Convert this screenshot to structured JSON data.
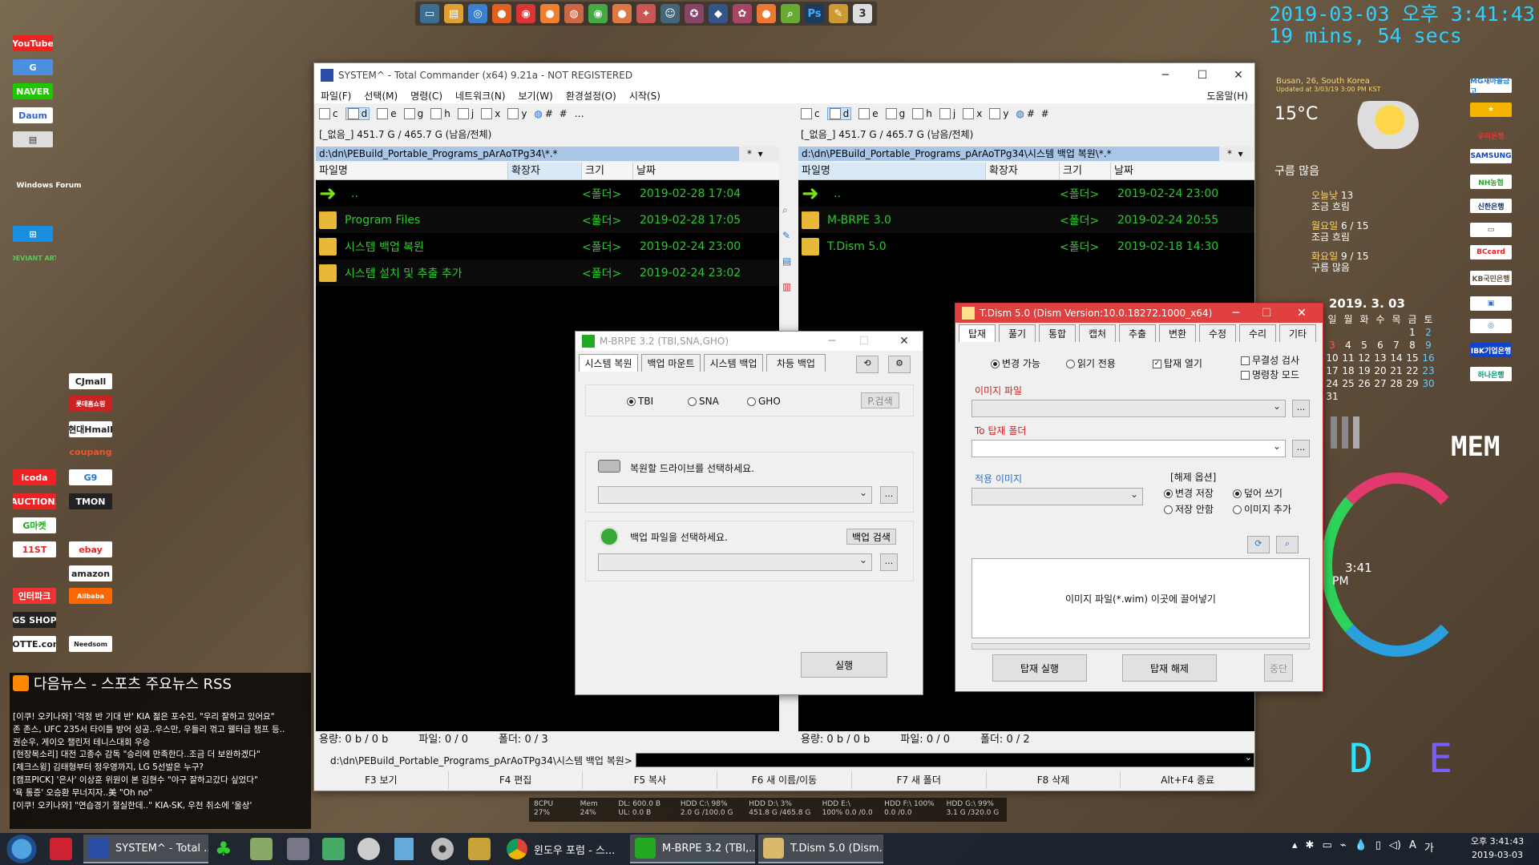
{
  "overlay_clock": {
    "datetime": "2019-03-03 오후 3:41:43",
    "uptime": "19 mins, 54 secs"
  },
  "tc": {
    "title": "SYSTEM^ - Total Commander (x64) 9.21a - NOT REGISTERED",
    "menu": [
      "파일(F)",
      "선택(M)",
      "명령(C)",
      "네트워크(N)",
      "보기(W)",
      "환경설정(O)",
      "시작(S)"
    ],
    "help": "도움말(H)",
    "drives": [
      "c",
      "d",
      "e",
      "g",
      "h",
      "j",
      "x",
      "y",
      "#",
      "…"
    ],
    "diskinfo": "[_없음_]  451.7 G / 465.7 G (남음/전체)",
    "left": {
      "path": "d:\\dn\\PEBuild_Portable_Programs_pArAoTPg34\\*.*",
      "cols": [
        "파일명",
        "확장자",
        "크기",
        "날짜"
      ],
      "rows": [
        {
          "name": "..",
          "size": "<폴더>",
          "date": "2019-02-28 17:04"
        },
        {
          "name": "Program Files",
          "size": "<폴더>",
          "date": "2019-02-28 17:05"
        },
        {
          "name": "시스템 백업 복원",
          "size": "<폴더>",
          "date": "2019-02-24 23:00"
        },
        {
          "name": "시스템 설치 및 추출 추가",
          "size": "<폴더>",
          "date": "2019-02-24 23:02"
        }
      ],
      "status": {
        "sel": "용량: 0 b / 0 b",
        "files": "파일: 0 / 0",
        "folders": "폴더: 0 / 3"
      }
    },
    "right": {
      "path": "d:\\dn\\PEBuild_Portable_Programs_pArAoTPg34\\시스템 백업 복원\\*.*",
      "cols": [
        "파일명",
        "확장자",
        "크기",
        "날짜"
      ],
      "rows": [
        {
          "name": "..",
          "size": "<폴더>",
          "date": "2019-02-24 23:00"
        },
        {
          "name": "M-BRPE 3.0",
          "size": "<폴더>",
          "date": "2019-02-24 20:55"
        },
        {
          "name": "T.Dism 5.0",
          "size": "<폴더>",
          "date": "2019-02-18 14:30"
        }
      ],
      "status": {
        "sel": "용량: 0 b / 0 b",
        "files": "파일: 0 / 0",
        "folders": "폴더: 0 / 2"
      }
    },
    "cmdpath": "d:\\dn\\PEBuild_Portable_Programs_pArAoTPg34\\시스템 백업 복원>",
    "fnkeys": [
      "F3 보기",
      "F4 편집",
      "F5 복사",
      "F6 새 이름/이동",
      "F7 새 폴더",
      "F8 삭제",
      "Alt+F4 종료"
    ]
  },
  "mbrpe": {
    "title": "M-BRPE 3.2 (TBI,SNA,GHO)",
    "tabs": [
      "시스템 복원",
      "백업 마운트",
      "시스템 백업",
      "차등 백업"
    ],
    "formats": [
      "TBI",
      "SNA",
      "GHO"
    ],
    "search_btn": "P.검색",
    "drive_label": "복원할 드라이브를 선택하세요.",
    "backup_label": "백업 파일을 선택하세요.",
    "backup_search": "백업 검색",
    "browse": "...",
    "run": "실행"
  },
  "tdism": {
    "title": "T.Dism 5.0 (Dism Version:10.0.18272.1000_x64)",
    "tabs": [
      "탑재",
      "풀기",
      "통합",
      "캡처",
      "추출",
      "변환",
      "수정",
      "수리",
      "기타"
    ],
    "opt_rw": "변경 가능",
    "opt_ro": "읽기 전용",
    "opt_open": "탑재 열기",
    "opt_integrity": "무결성 검사",
    "opt_cmd": "명령창 모드",
    "image_file": "이미지 파일",
    "mount_folder": "To 탑재 폴더",
    "apply_image": "적용 이미지",
    "unmount_opts": "[해제 옵션]",
    "save": "변경 저장",
    "overwrite": "덮어 쓰기",
    "nosave": "저장 안함",
    "add_image": "이미지 추가",
    "drop": "이미지 파일(*.wim) 이곳에 끌어넣기",
    "mount_btn": "탑재 실행",
    "unmount_btn": "탑재 해제",
    "stop_btn": "중단",
    "browse": "..."
  },
  "news": {
    "title": "다음뉴스 - 스포츠 주요뉴스 RSS",
    "items": [
      "[이쿠! 오키나와] '걱정 반 기대 반' KIA 젊은 포수진, \"우리 잘하고 있어요\"",
      "존 존스, UFC 235서 타이틀 방어 성공..우스만, 우들리 꺾고 웰터급 챔프 등..",
      "권순우, 게이오 챌린저 테니스대회 우승",
      "[현장목소리] 대전 고종수 감독 \"승리에 만족한다..조금 더 보완하겠다\"",
      "[체크스윙] 김태형부터 정우영까지, LG 5선발은 누구?",
      "[캠프PICK] '은사' 이상훈 위원이 본 김현수 \"야구 잘하고갔다 싶었다\"",
      "'욕 통증' 오승환 무너지자..美 \"Oh no\"",
      "[이쿠! 오키나와] \"연습경기 절실한데..\" KIA-SK, 우천 취소에 '울상'"
    ]
  },
  "weather": {
    "location": "Busan, 26, South Korea",
    "updated": "Updated at 3/03/19 3:00 PM KST",
    "temp": "15°C",
    "condition": "구름 많음",
    "forecast": [
      {
        "day": "오늘낮",
        "temp": "13",
        "desc": "조금 흐림"
      },
      {
        "day": "월요일",
        "temp": "6 / 15",
        "desc": "조금 흐림"
      },
      {
        "day": "화요일",
        "temp": "9 / 15",
        "desc": "구름 많음"
      }
    ]
  },
  "calendar": {
    "header": "2019. 3. 03",
    "weekdays": [
      "일",
      "월",
      "화",
      "수",
      "목",
      "금",
      "토"
    ],
    "weeks": [
      [
        "",
        "",
        "",
        "",
        "",
        "1",
        "2"
      ],
      [
        "3",
        "4",
        "5",
        "6",
        "7",
        "8",
        "9"
      ],
      [
        "10",
        "11",
        "12",
        "13",
        "14",
        "15",
        "16"
      ],
      [
        "17",
        "18",
        "19",
        "20",
        "21",
        "22",
        "23"
      ],
      [
        "24",
        "25",
        "26",
        "27",
        "28",
        "29",
        "30"
      ],
      [
        "31",
        "",
        "",
        "",
        "",
        "",
        ""
      ]
    ]
  },
  "sysmon": {
    "cpu": "8CPU 27%",
    "mem": "Mem 24%",
    "dl": "DL: 600.0 B",
    "ul": "UL: 0.0 B",
    "hddc": "HDD C:\\ 98% 2.0 G /100.0 G",
    "hddd": "HDD D:\\ 3% 451.8 G /465.8 G",
    "hdde": "HDD E:\\ 100% 0.0 /0.0",
    "hddf": "HDD F:\\ 100% 0.0 /0.0",
    "hddg": "HDD G:\\ 99% 3.1 G /320.0 G"
  },
  "gadget": {
    "mem": "MEM",
    "time": "3:41",
    "ampm": "PM",
    "d": "D",
    "e": "E"
  },
  "taskbar": {
    "items": [
      "SYSTEM^ - Total ...",
      "윈도우 포럼 - 스...",
      "M-BRPE 3.2 (TBI,...",
      "T.Dism 5.0 (Dism..."
    ],
    "time": "오후 3:41:43",
    "date": "2019-03-03"
  },
  "desktop_left": [
    "YouTube",
    "NAVER",
    "Daum",
    "Windows Forum",
    "DEVIANT ART",
    "G마켓",
    "AUCTION.",
    "11ST",
    "인터파크",
    "GS SHOP",
    "LOTTE.com",
    "CJmall",
    "롯데홈쇼핑",
    "현대Hmall",
    "coupang",
    "G9",
    "TMON",
    "ebay",
    "amazon",
    "Alibaba",
    "Needsom",
    "icoda"
  ],
  "desktop_right": [
    "MG새마을금고",
    "IBK기업은행",
    "KB국민은행",
    "NH농협",
    "SAMSUNG",
    "BCcard",
    "우리은행",
    "하나은행",
    "신한은행"
  ]
}
